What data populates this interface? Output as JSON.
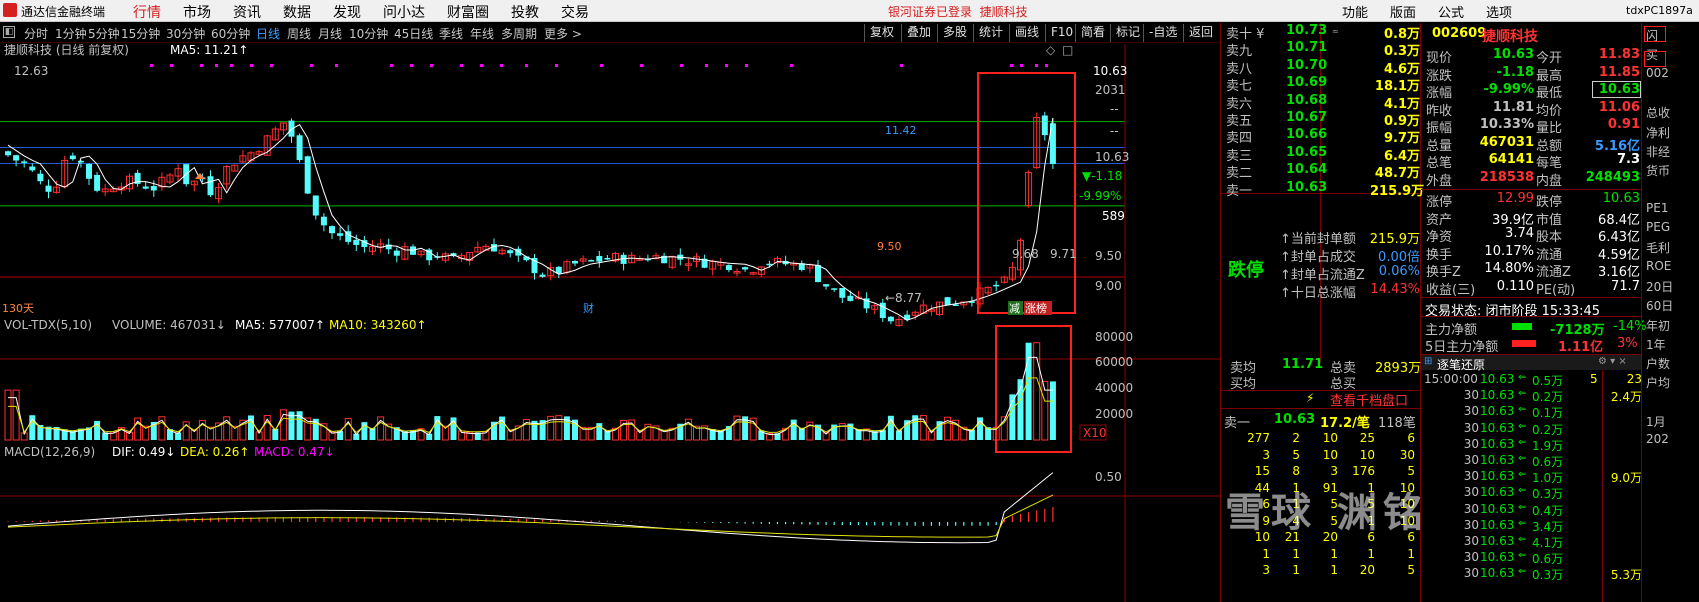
{
  "menubar": {
    "app_title": "通达信金融终端",
    "menu": [
      "行情",
      "市场",
      "资讯",
      "数据",
      "发现",
      "问小达",
      "财富圈",
      "投教",
      "交易"
    ],
    "active": "行情",
    "broker_status": "银河证券已登录",
    "stock_link": "捷顺科技",
    "right_menu": [
      "功能",
      "版面",
      "公式",
      "选项"
    ],
    "user_id": "tdxPC1897a"
  },
  "toolbar": {
    "timeframes": [
      "分时",
      "1分钟",
      "5分钟",
      "15分钟",
      "30分钟",
      "60分钟",
      "日线",
      "周线",
      "月线",
      "10分钟",
      "45日线",
      "季线",
      "年线",
      "多周期",
      "更多 >"
    ],
    "active_timeframe": "日线",
    "buttons": [
      "复权",
      "叠加",
      "多股",
      "统计",
      "画线",
      "F10",
      "简看",
      "标记",
      "-自选",
      "返回"
    ]
  },
  "main_chart": {
    "title": "捷顺科技 (日线 前复权)",
    "ma_label": "MA5: 11.21↑",
    "price_marker": "12.63",
    "label_1142": "11.42",
    "label_950": "9.50",
    "label_968": "9.68",
    "label_971": "9.71",
    "label_877": "←8.77",
    "days": "130天",
    "cai": "财",
    "tag_jian": "减",
    "tag_zhangbang": "涨榜",
    "axis": [
      "10.63",
      "2031",
      "--",
      "--",
      "10.63",
      "▼-1.18",
      "-9.99%",
      "589",
      "9.50",
      "9.00"
    ]
  },
  "volume_chart": {
    "label_name": "VOL-TDX(5,10)",
    "label_volume": "VOLUME: 467031↓",
    "label_ma5": "MA5: 577007↑",
    "label_ma10": "MA10: 343260↑",
    "axis": [
      "80000",
      "60000",
      "40000",
      "20000",
      "X10"
    ]
  },
  "macd_chart": {
    "label_name": "MACD(12,26,9)",
    "label_dif": "DIF: 0.49↓",
    "label_dea": "DEA: 0.26↑",
    "label_macd": "MACD: 0.47↓",
    "axis": [
      "0.50"
    ]
  },
  "orderbook": {
    "sells": [
      {
        "name": "卖十 ¥",
        "price": "10.73",
        "vol": "0.8万",
        "mark": "≈"
      },
      {
        "name": "卖九",
        "price": "10.71",
        "vol": "0.3万"
      },
      {
        "name": "卖八",
        "price": "10.70",
        "vol": "4.6万"
      },
      {
        "name": "卖七",
        "price": "10.69",
        "vol": "18.1万"
      },
      {
        "name": "卖六",
        "price": "10.68",
        "vol": "4.1万"
      },
      {
        "name": "卖五",
        "price": "10.67",
        "vol": "0.9万"
      },
      {
        "name": "卖四",
        "price": "10.66",
        "vol": "9.7万"
      },
      {
        "name": "卖三",
        "price": "10.65",
        "vol": "6.4万"
      },
      {
        "name": "卖二",
        "price": "10.64",
        "vol": "48.7万"
      },
      {
        "name": "卖一",
        "price": "10.63",
        "vol": "215.9万"
      }
    ],
    "limit_label": "跌停",
    "seal": [
      {
        "label": "当前封单额",
        "value": "215.9万"
      },
      {
        "label": "封单占成交",
        "value": "0.00倍"
      },
      {
        "label": "封单占流通Z",
        "value": "0.06%"
      },
      {
        "label": "十日总涨幅",
        "value": "14.43%"
      }
    ],
    "avg_sell_label": "卖均",
    "avg_sell": "11.71",
    "avg_buy_label": "买均",
    "total_sell_label": "总卖",
    "total_sell": "2893万",
    "total_buy_label": "总买",
    "qianjia": "查看千档盘口",
    "s1_label": "卖一",
    "s1_price": "10.63",
    "s1_vol": "17.2/笔",
    "s1_cnt": "118笔",
    "queue": [
      [
        "277",
        "2",
        "10",
        "25",
        "6"
      ],
      [
        "3",
        "5",
        "10",
        "10",
        "30"
      ],
      [
        "15",
        "8",
        "3",
        "176",
        "5"
      ],
      [
        "44",
        "1",
        "91",
        "1",
        "10"
      ],
      [
        "6",
        "1",
        "5",
        "5",
        "10"
      ],
      [
        "9",
        "4",
        "5",
        "1",
        "10"
      ],
      [
        "10",
        "21",
        "20",
        "6",
        "6"
      ],
      [
        "1",
        "1",
        "1",
        "1",
        "1"
      ],
      [
        "3",
        "1",
        "1",
        "20",
        "5"
      ]
    ]
  },
  "quote": {
    "code": "002609",
    "name": "捷顺科技",
    "rows": [
      [
        "现价",
        "10.63",
        "今开",
        "11.83"
      ],
      [
        "涨跌",
        "-1.18",
        "最高",
        "11.85"
      ],
      [
        "涨幅",
        "-9.99%",
        "最低",
        "10.63"
      ],
      [
        "昨收",
        "11.81",
        "均价",
        "11.06"
      ],
      [
        "振幅",
        "10.33%",
        "量比",
        "0.91"
      ],
      [
        "总量",
        "467031",
        "总额",
        "5.16亿"
      ],
      [
        "总笔",
        "64141",
        "每笔",
        "7.3"
      ],
      [
        "外盘",
        "218538",
        "内盘",
        "248493"
      ]
    ],
    "rows2": [
      [
        "涨停",
        "12.99",
        "跌停",
        "10.63"
      ],
      [
        "资产",
        "39.9亿",
        "市值",
        "68.4亿"
      ],
      [
        "净资",
        "3.74",
        "股本",
        "6.43亿"
      ],
      [
        "换手",
        "10.17%",
        "流通",
        "4.59亿"
      ],
      [
        "换手Z",
        "14.80%",
        "流通Z",
        "3.16亿"
      ],
      [
        "收益(三)",
        "0.110",
        "PE(动)",
        "71.7"
      ]
    ],
    "trade_status": "交易状态: 闭市阶段 15:33:45",
    "main_net_label": "主力净额",
    "main_net": "-7128万",
    "main_net_pct": "-14%",
    "main5_label": "5日主力净额",
    "main5": "1.11亿",
    "main5_pct": "3%",
    "ticks_title": "逐笔还原",
    "ticks": [
      [
        "15:00:00",
        "10.63",
        "0.5万",
        "5"
      ],
      [
        "30",
        "10.63",
        "0.2万",
        ""
      ],
      [
        "30",
        "10.63",
        "0.1万",
        ""
      ],
      [
        "30",
        "10.63",
        "0.2万",
        ""
      ],
      [
        "30",
        "10.63",
        "1.9万",
        ""
      ],
      [
        "30",
        "10.63",
        "0.6万",
        ""
      ],
      [
        "30",
        "10.63",
        "1.0万",
        ""
      ],
      [
        "30",
        "10.63",
        "0.3万",
        ""
      ],
      [
        "30",
        "10.63",
        "0.4万",
        ""
      ],
      [
        "30",
        "10.63",
        "3.4万",
        ""
      ],
      [
        "30",
        "10.63",
        "4.1万",
        ""
      ],
      [
        "30",
        "10.63",
        "0.6万",
        ""
      ],
      [
        "30",
        "10.63",
        "0.3万",
        ""
      ]
    ],
    "tick_side": [
      "23",
      "2.4万",
      "",
      "",
      "",
      "",
      "9.0万",
      "",
      "",
      "",
      "",
      "",
      "5.3万"
    ]
  },
  "farright": {
    "labels": [
      "闪",
      "买",
      "002",
      "",
      "总收",
      "净利",
      "非经",
      "货币",
      "",
      "PE1",
      "PEG",
      "毛利",
      "ROE",
      "20日",
      "60日",
      "年初",
      "1年",
      "户数",
      "户均",
      "",
      "1月",
      "202"
    ]
  },
  "watermark": "雪球 渊铭"
}
